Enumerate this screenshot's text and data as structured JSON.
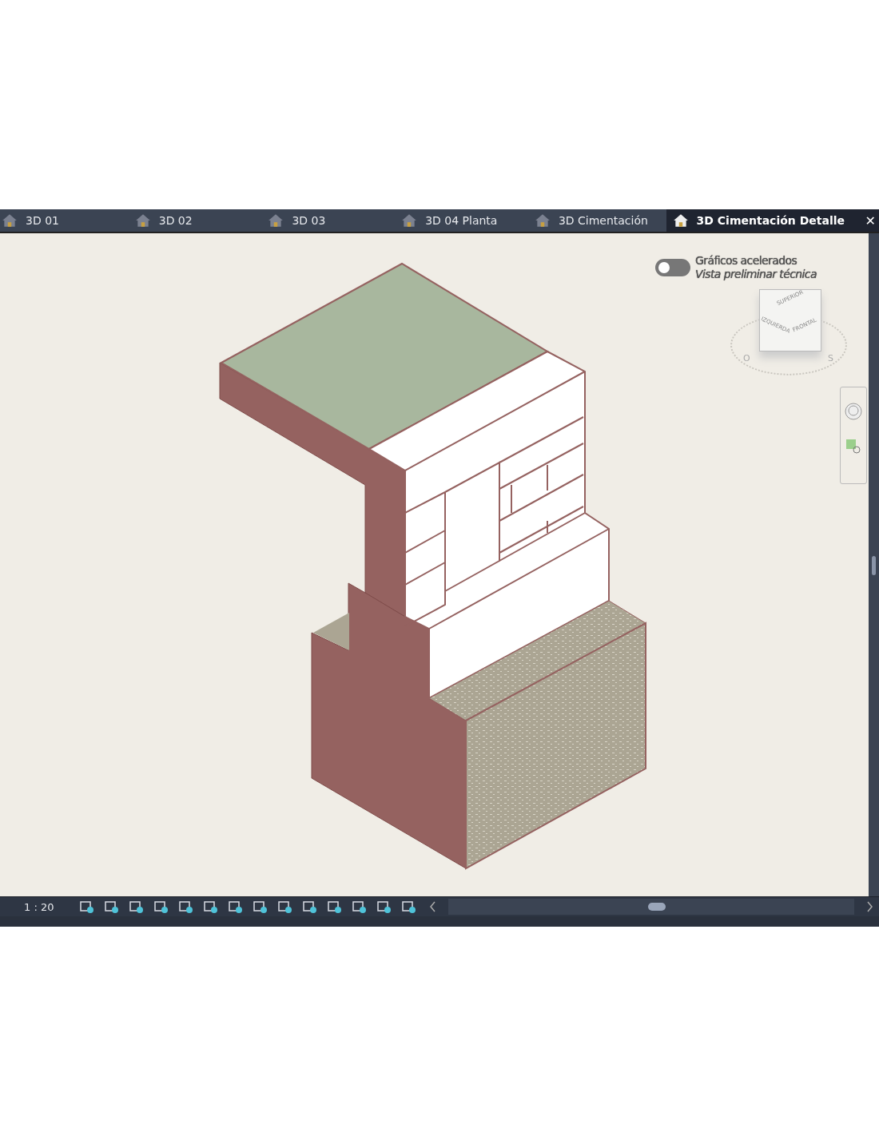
{
  "tabs": [
    {
      "label": "3D 01",
      "selected": false
    },
    {
      "label": "3D 02",
      "selected": false
    },
    {
      "label": "3D 03",
      "selected": false
    },
    {
      "label": "3D 04 Planta",
      "selected": false
    },
    {
      "label": "3D Cimentación",
      "selected": false
    },
    {
      "label": "3D Cimentación  Detalle",
      "selected": true
    }
  ],
  "close_symbol": "✕",
  "graphics_toggle": {
    "on": false,
    "title": "Gráficos acelerados",
    "subtitle": "Vista preliminar técnica"
  },
  "view_cube": {
    "top": "SUPERIOR",
    "left": "IZQUIERDA",
    "front": "FRONTAL",
    "compass": [
      "O",
      "S"
    ]
  },
  "status_bar": {
    "scale": "1 : 20"
  }
}
